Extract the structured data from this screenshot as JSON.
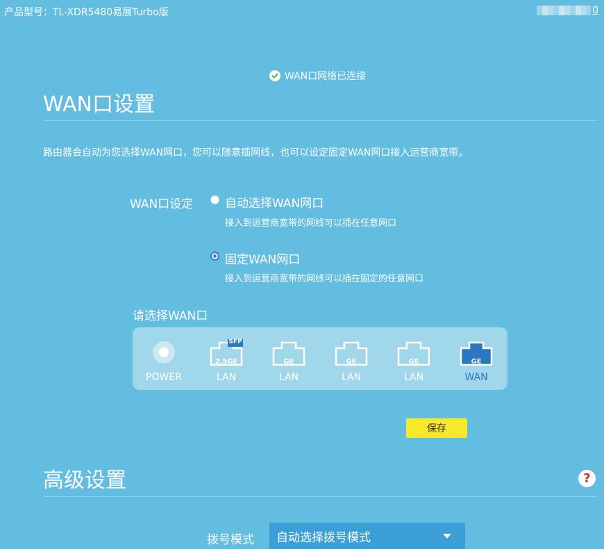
{
  "topbar": {
    "model": "产品型号：TL-XDR5480易展Turbo版",
    "user_suffix": "0"
  },
  "status": {
    "text": "WAN口网络已连接",
    "icon": "check-circle-icon"
  },
  "wan_section": {
    "title": "WAN口设置",
    "description": "路由器会自动为您选择WAN网口，您可以随意插网线，也可以设定固定WAN网口接入运营商宽带。",
    "field_label": "WAN口设定",
    "options": [
      {
        "label": "自动选择WAN网口",
        "sub": "接入到运营商宽带的网线可以插在任意网口",
        "checked": false
      },
      {
        "label": "固定WAN网口",
        "sub": "接入到运营商宽带的网线可以插在固定的任意网口",
        "checked": true
      }
    ],
    "select_label": "请选择WAN口",
    "ports": [
      {
        "caption": "POWER",
        "badge": ""
      },
      {
        "caption": "LAN",
        "badge": "2.5GE",
        "tag": "SFP"
      },
      {
        "caption": "LAN",
        "badge": "GE"
      },
      {
        "caption": "LAN",
        "badge": "GE"
      },
      {
        "caption": "LAN",
        "badge": "GE"
      },
      {
        "caption": "WAN",
        "badge": "GE",
        "selected": true
      }
    ],
    "save_label": "保存"
  },
  "advanced_section": {
    "title": "高级设置",
    "help_icon": "question-mark-icon",
    "dial_label": "拨号模式",
    "dial_value": "自动选择拨号模式"
  },
  "colors": {
    "background": "#62bde0",
    "save_button": "#f7e92a",
    "wan_port": "#2b78c2",
    "select": "#3c9fd6"
  }
}
